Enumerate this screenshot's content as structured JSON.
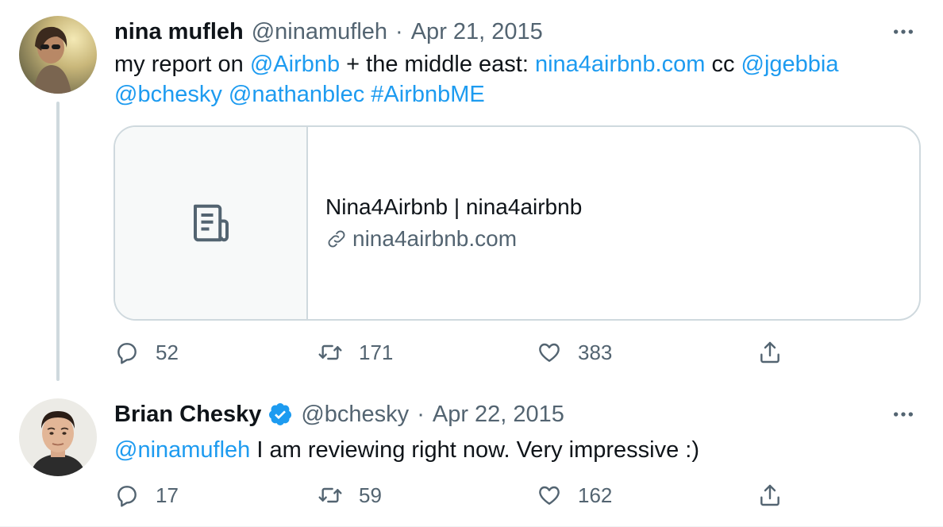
{
  "tweets": [
    {
      "author_name": "nina mufleh",
      "handle": "@ninamufleh",
      "date": "Apr 21, 2015",
      "text_segments": [
        {
          "text": "my report on ",
          "type": "plain"
        },
        {
          "text": "@Airbnb",
          "type": "link"
        },
        {
          "text": " + the middle east: ",
          "type": "plain"
        },
        {
          "text": "nina4airbnb.com",
          "type": "link"
        },
        {
          "text": " cc ",
          "type": "plain"
        },
        {
          "text": "@jgebbia",
          "type": "link"
        },
        {
          "text": " ",
          "type": "plain"
        },
        {
          "text": "@bchesky",
          "type": "link"
        },
        {
          "text": " ",
          "type": "plain"
        },
        {
          "text": "@nathanblec",
          "type": "link"
        },
        {
          "text": " ",
          "type": "plain"
        },
        {
          "text": "#AirbnbME",
          "type": "link"
        }
      ],
      "card": {
        "title": "Nina4Airbnb | nina4airbnb",
        "domain": "nina4airbnb.com",
        "thumb_icon": "document-icon",
        "domain_icon": "link-icon"
      },
      "stats": {
        "replies": "52",
        "retweets": "171",
        "likes": "383"
      }
    },
    {
      "author_name": "Brian Chesky",
      "verified": true,
      "handle": "@bchesky",
      "date": "Apr 22, 2015",
      "text_segments": [
        {
          "text": "@ninamufleh",
          "type": "link"
        },
        {
          "text": " I am reviewing right now. Very impressive :)",
          "type": "plain"
        }
      ],
      "stats": {
        "replies": "17",
        "retweets": "59",
        "likes": "162"
      }
    }
  ],
  "separator": "·",
  "colors": {
    "link": "#1d9bf0",
    "secondary_text": "#536471",
    "primary_text": "#0f1419",
    "border": "#cfd9de",
    "card_thumb_bg": "#f7f9f9"
  },
  "icons": [
    "reply-icon",
    "retweet-icon",
    "like-icon",
    "share-icon",
    "more-icon",
    "verified-badge-icon"
  ]
}
